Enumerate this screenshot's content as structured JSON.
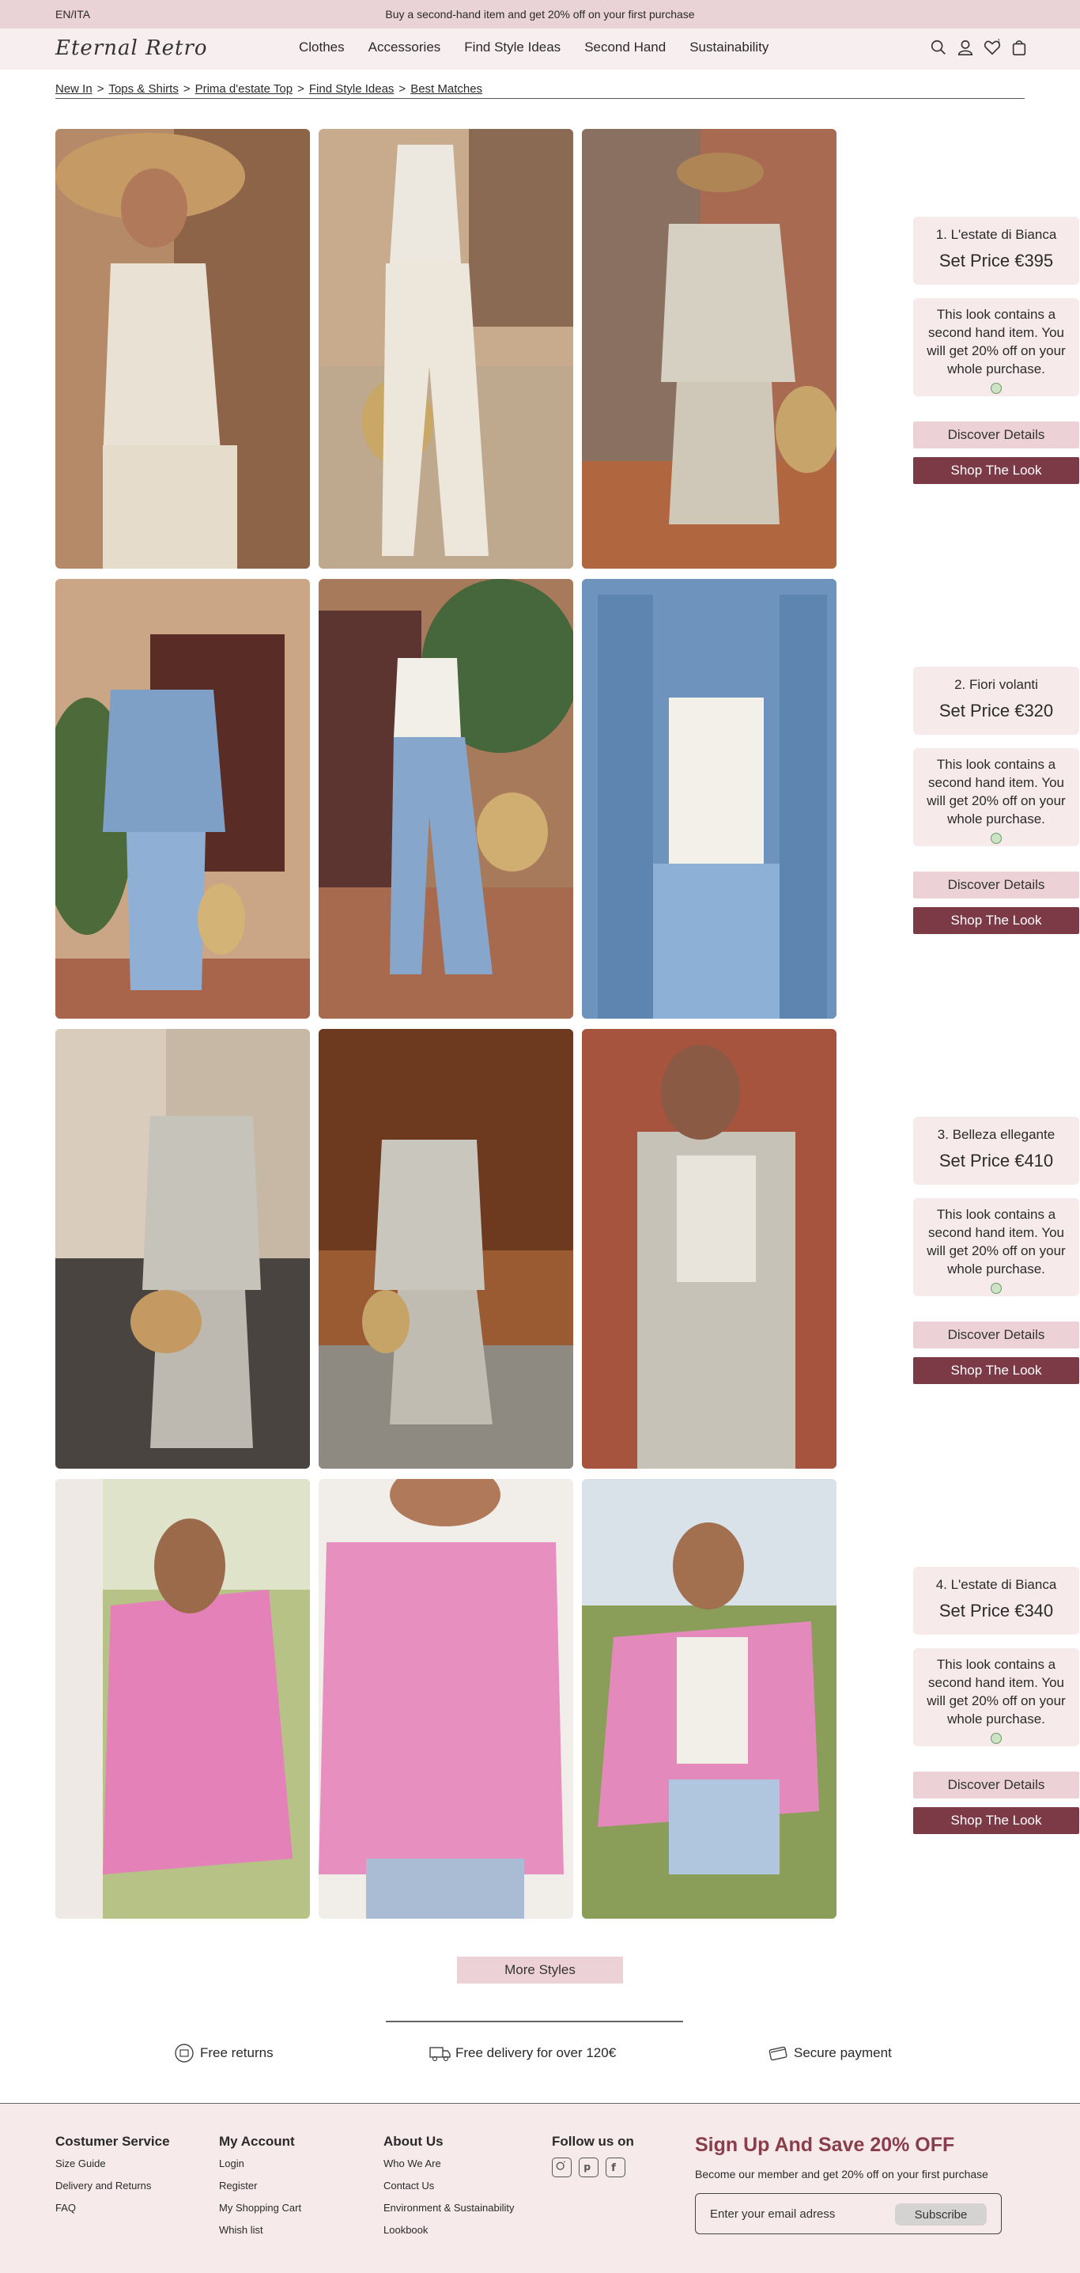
{
  "topbar": {
    "lang": "EN/ITA",
    "promo": "Buy a second-hand item and get 20% off on your first purchase"
  },
  "nav": {
    "logo": "Eternal Retro",
    "menu": [
      "Clothes",
      "Accessories",
      "Find Style Ideas",
      "Second Hand",
      "Sustainability"
    ],
    "icons": [
      "search-icon",
      "account-icon",
      "wishlist-icon",
      "cart-icon"
    ]
  },
  "breadcrumb": [
    "New In",
    "Tops & Shirts",
    "Prima d'estate Top",
    "Find Style Ideas",
    "Best Matches"
  ],
  "looks": [
    {
      "title": "1. L'estate di Bianca",
      "price": "Set Price  €395",
      "info": "This look contains a second hand item. You will get 20% off on your whole purchase.",
      "discover": "Discover Details",
      "shop": "Shop The Look"
    },
    {
      "title": "2. Fiori volanti",
      "price": "Set Price  €320",
      "info": "This look contains a second hand item. You will get 20% off on your whole purchase.",
      "discover": "Discover Details",
      "shop": "Shop The Look"
    },
    {
      "title": "3. Belleza ellegante",
      "price": "Set Price  €410",
      "info": "This look contains a second hand item. You will get 20% off on your whole purchase.",
      "discover": "Discover Details",
      "shop": "Shop The Look"
    },
    {
      "title": "4. L'estate di Bianca",
      "price": "Set Price  €340",
      "info": "This look contains a second hand item. You will get 20% off on your whole purchase.",
      "discover": "Discover Details",
      "shop": "Shop The Look"
    }
  ],
  "more_styles": "More Styles",
  "perks": [
    "Free returns",
    "Free delivery for over 120€",
    "Secure payment"
  ],
  "footer": {
    "service": {
      "title": "Costumer Service",
      "links": [
        "Size Guide",
        "Delivery and Returns",
        "FAQ"
      ]
    },
    "account": {
      "title": "My Account",
      "links": [
        "Login",
        "Register",
        "My Shopping Cart",
        "Whish list"
      ]
    },
    "about": {
      "title": "About Us",
      "links": [
        "Who We Are",
        "Contact Us",
        "Environment & Sustainability",
        "Lookbook"
      ]
    },
    "follow": {
      "title": "Follow us on",
      "icons": [
        "instagram-icon",
        "pinterest-icon",
        "facebook-icon"
      ]
    },
    "signup": {
      "title": "Sign Up And Save 20% OFF",
      "text": "Become our member and get 20% off on your first purchase",
      "placeholder": "Enter your email adress",
      "button": "Subscribe"
    }
  },
  "colors": {
    "accent": "#7c3a47",
    "pink_light": "#f6eaeb",
    "pink_button": "#ecd2d6",
    "topbar": "#ead3d6",
    "signup_title": "#8a3d4a"
  }
}
